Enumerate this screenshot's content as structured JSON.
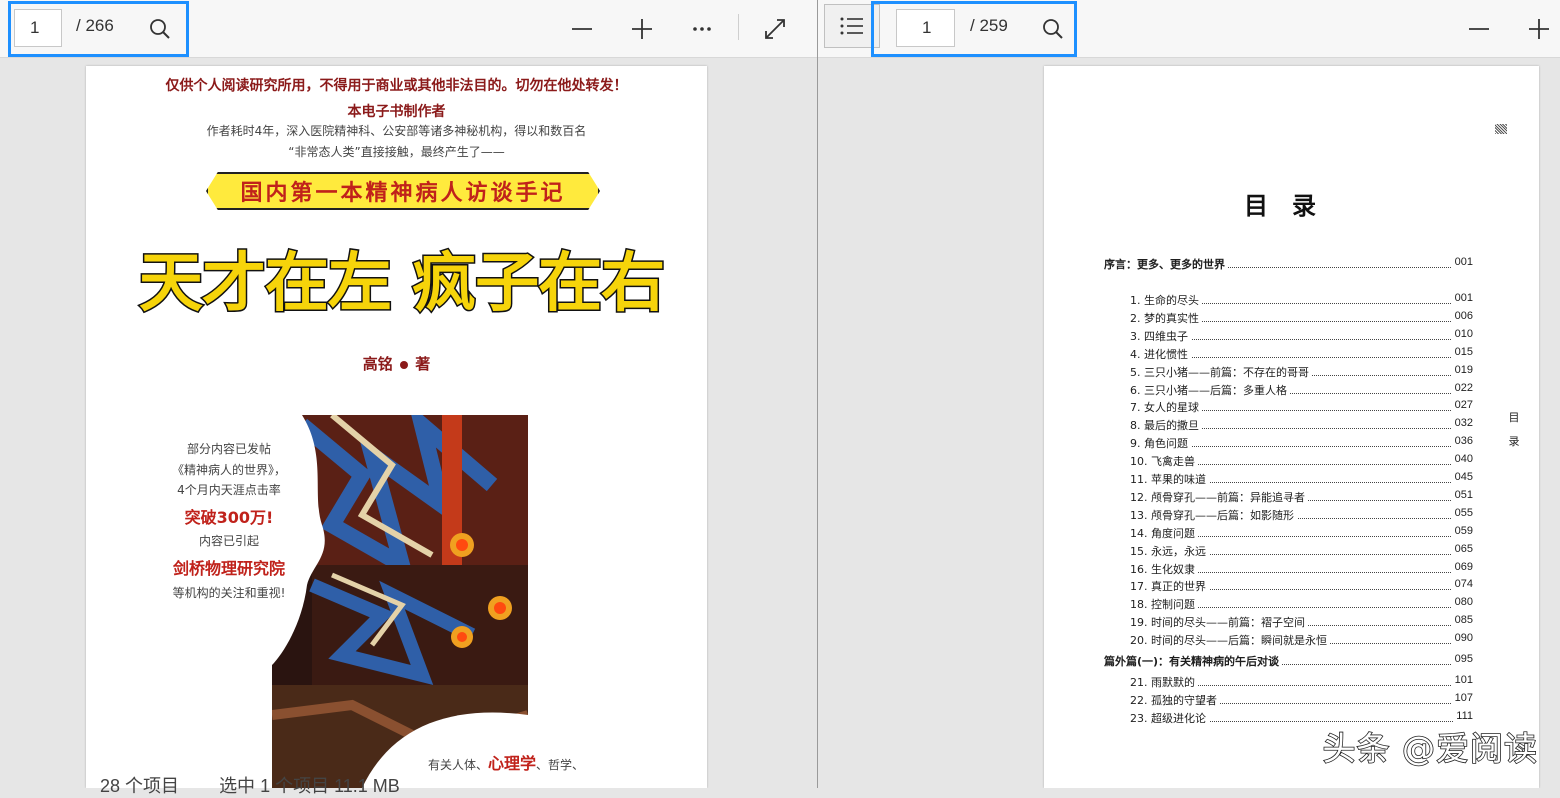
{
  "left_viewer": {
    "page_number": "1",
    "page_total": "/ 266"
  },
  "right_viewer": {
    "page_number": "1",
    "page_total": "/ 259"
  },
  "status_bar": {
    "items": "28 个项目",
    "selected": "选中 1 个项目  11.1 MB"
  },
  "book_cover": {
    "warning": "仅供个人阅读研究所用，不得用于商业或其他非法目的。切勿在他处转发！",
    "maker": "本电子书制作者",
    "intro_line1": "作者耗时4年，深入医院精神科、公安部等诸多神秘机构，得以和数百名",
    "intro_line2": "“非常态人类”直接接触，最终产生了——",
    "banner": "国内第一本精神病人访谈手记",
    "title": "天才在左 疯子在右",
    "author": "高铭",
    "author_suffix": "著",
    "blurb_line1": "部分内容已发帖",
    "blurb_line2": "《精神病人的世界》，",
    "blurb_line3": "4个月内天涯点击率",
    "blurb_highlight1": "突破300万!",
    "blurb_line4": "内容已引起",
    "blurb_highlight2": "剑桥物理研究院",
    "blurb_line5": "等机构的关注和重视!",
    "bottom_prefix": "有关人体、",
    "bottom_highlight": "心理学",
    "bottom_suffix": "、哲学、"
  },
  "toc": {
    "heading": "目　录",
    "side_label": "目\n录",
    "entries": [
      {
        "text": "序言：更多、更多的世界",
        "page": "001",
        "bold": true
      },
      {
        "text": "1. 生命的尽头",
        "page": "001"
      },
      {
        "text": "2. 梦的真实性",
        "page": "006"
      },
      {
        "text": "3. 四维虫子",
        "page": "010"
      },
      {
        "text": "4. 进化惯性",
        "page": "015"
      },
      {
        "text": "5. 三只小猪——前篇：不存在的哥哥",
        "page": "019"
      },
      {
        "text": "6. 三只小猪——后篇：多重人格",
        "page": "022"
      },
      {
        "text": "7. 女人的星球",
        "page": "027"
      },
      {
        "text": "8. 最后的撒旦",
        "page": "032"
      },
      {
        "text": "9. 角色问题",
        "page": "036"
      },
      {
        "text": "10. 飞禽走兽",
        "page": "040"
      },
      {
        "text": "11. 苹果的味道",
        "page": "045"
      },
      {
        "text": "12. 颅骨穿孔——前篇：异能追寻者",
        "page": "051"
      },
      {
        "text": "13. 颅骨穿孔——后篇：如影随形",
        "page": "055"
      },
      {
        "text": "14. 角度问题",
        "page": "059"
      },
      {
        "text": "15. 永远，永远",
        "page": "065"
      },
      {
        "text": "16. 生化奴隶",
        "page": "069"
      },
      {
        "text": "17. 真正的世界",
        "page": "074"
      },
      {
        "text": "18. 控制问题",
        "page": "080"
      },
      {
        "text": "19. 时间的尽头——前篇：褶子空间",
        "page": "085"
      },
      {
        "text": "20. 时间的尽头——后篇：瞬间就是永恒",
        "page": "090"
      },
      {
        "text": "篇外篇(一)：有关精神病的午后对谈",
        "page": "095",
        "bold": true
      },
      {
        "text": "21. 雨默默的",
        "page": "101"
      },
      {
        "text": "22. 孤独的守望者",
        "page": "107"
      },
      {
        "text": "23. 超级进化论",
        "page": "111"
      }
    ]
  },
  "watermark": "头条 @爱阅读",
  "colors": {
    "highlight_border": "#1e90ff",
    "title_yellow": "#f6d40a",
    "banner_red": "#c0221b",
    "cover_dark_red": "#8b1a1a"
  }
}
